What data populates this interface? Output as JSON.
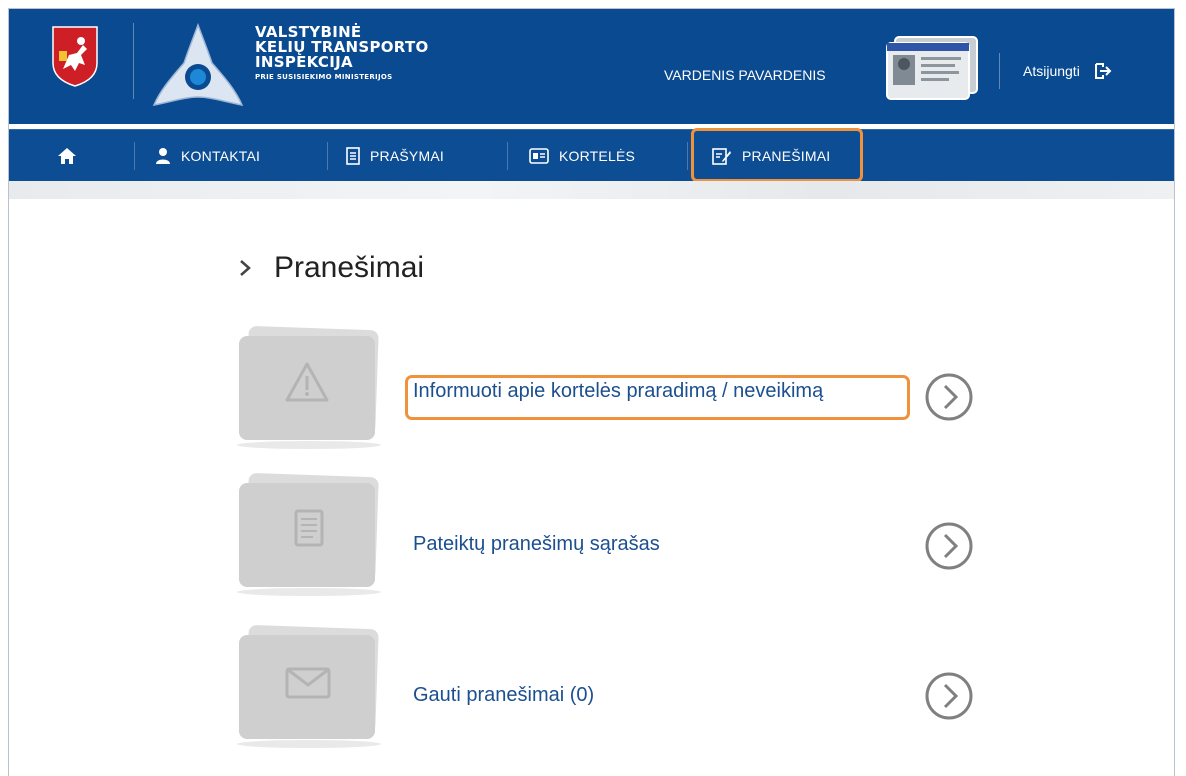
{
  "header": {
    "org_line1": "VALSTYBINĖ",
    "org_line2": "KELIŲ TRANSPORTO",
    "org_line3": "INSPEKCIJA",
    "org_sub": "PRIE SUSISIEKIMO MINISTERIJOS",
    "user_name": "VARDENIS PAVARDENIS",
    "logout_label": "Atsijungti"
  },
  "nav": {
    "items": [
      {
        "label": "KONTAKTAI",
        "icon": "person-icon"
      },
      {
        "label": "PRAŠYMAI",
        "icon": "document-icon"
      },
      {
        "label": "KORTELĖS",
        "icon": "id-card-icon"
      },
      {
        "label": "PRANEŠIMAI",
        "icon": "edit-icon",
        "active": true
      }
    ]
  },
  "page": {
    "title": "Pranešimai"
  },
  "rows": [
    {
      "label": "Informuoti apie kortelės praradimą / neveikimą",
      "icon": "warning-icon",
      "highlighted": true
    },
    {
      "label": "Pateiktų pranešimų sąrašas",
      "icon": "list-icon"
    },
    {
      "label": "Gauti pranešimai (0)",
      "icon": "envelope-icon"
    }
  ],
  "colors": {
    "header_bg": "#0a4a91",
    "highlight": "#f0923b",
    "link": "#1c4f8f"
  }
}
